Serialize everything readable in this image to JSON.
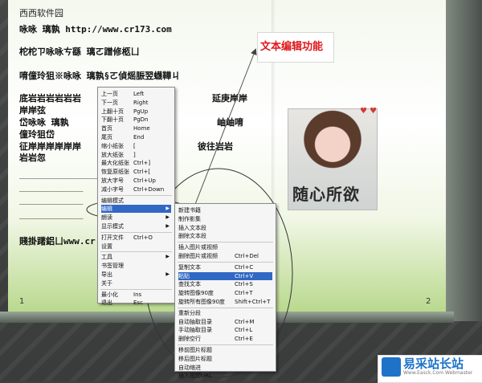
{
  "header": "西西软件园",
  "book_lines": [
    "咏咏  璃孰 http://www.cr173.com",
    "柁柁ㄗ咏咏ㄘ繇  璃ㄛ蹭修柩ㄩ",
    "唷僮玲狙※咏咏  璃孰§ㄛ偵熎脤翌蠛鞾ㄐ",
    "底岩岩岩岩岩岩",
    "岸岸弦",
    "岱咏咏  璃孰",
    "僮玲狙岱",
    "征岸岸岸岸岸岸",
    "岩岩忽",
    "_______________",
    "____________",
    "____________",
    "____________",
    "賤掛躇鋁ㄩwww.cr"
  ],
  "book_right_fragments": [
    "延庚岸岸",
    "岫岫唷",
    "彼往岩岩"
  ],
  "page_numbers": {
    "left": "1",
    "right": "2"
  },
  "annotation": "文本编辑功能",
  "photo_caption": "随心所欲",
  "menu_main": [
    {
      "label": "上一页",
      "key": "Left"
    },
    {
      "label": "下一页",
      "key": "Right"
    },
    {
      "label": "上翻十页",
      "key": "PgUp"
    },
    {
      "label": "下翻十页",
      "key": "PgDn"
    },
    {
      "label": "首页",
      "key": "Home"
    },
    {
      "label": "尾页",
      "key": "End"
    },
    {
      "label": "缩小纸张",
      "key": "["
    },
    {
      "label": "放大纸张",
      "key": "]"
    },
    {
      "label": "最大化纸张",
      "key": "Ctrl+]"
    },
    {
      "label": "恢复原纸张",
      "key": "Ctrl+["
    },
    {
      "label": "放大字号",
      "key": "Ctrl+Up"
    },
    {
      "label": "减小字号",
      "key": "Ctrl+Down"
    },
    {
      "label": "编辑模式",
      "key": ""
    },
    {
      "label": "编辑",
      "key": "",
      "submenu": true,
      "selected": true
    },
    {
      "label": "朗读",
      "key": "",
      "submenu": true
    },
    {
      "label": "显示模式",
      "key": "",
      "submenu": true
    },
    {
      "label": "打开文件",
      "key": "Ctrl+O"
    },
    {
      "label": "设置",
      "key": ""
    },
    {
      "label": "工具",
      "key": "",
      "submenu": true
    },
    {
      "label": "书签管理",
      "key": ""
    },
    {
      "label": "导出",
      "key": "",
      "submenu": true
    },
    {
      "label": "关于",
      "key": ""
    },
    {
      "label": "最小化",
      "key": "Ins"
    },
    {
      "label": "退出",
      "key": "Esc"
    }
  ],
  "menu_edit": [
    {
      "label": "新建书籍",
      "key": ""
    },
    {
      "label": "制作影集",
      "key": ""
    },
    {
      "label": "插入文本段",
      "key": ""
    },
    {
      "label": "删除文本段",
      "key": ""
    },
    {
      "label": "插入图片或视频",
      "key": ""
    },
    {
      "label": "删除图片或视频",
      "key": "Ctrl+Del"
    },
    {
      "label": "复制文本",
      "key": "Ctrl+C"
    },
    {
      "label": "粘贴",
      "key": "Ctrl+V",
      "selected": true
    },
    {
      "label": "查找文本",
      "key": "Ctrl+S"
    },
    {
      "label": "旋转图像90度",
      "key": "Ctrl+T"
    },
    {
      "label": "旋转所有图像90度",
      "key": "Shift+Ctrl+T"
    },
    {
      "label": "重新分段",
      "key": ""
    },
    {
      "label": "自动抽取目录",
      "key": "Ctrl+M"
    },
    {
      "label": "手动抽取目录",
      "key": "Ctrl+L"
    },
    {
      "label": "删除空行",
      "key": "Ctrl+E"
    },
    {
      "label": "移前图片标题",
      "key": ""
    },
    {
      "label": "移后图片标题",
      "key": ""
    },
    {
      "label": "自动缩进",
      "key": ""
    },
    {
      "label": "插入视频URL",
      "key": ""
    }
  ],
  "logo": {
    "title": "易采站长站",
    "subtitle": "Www.Easck.Com Webmaster"
  }
}
